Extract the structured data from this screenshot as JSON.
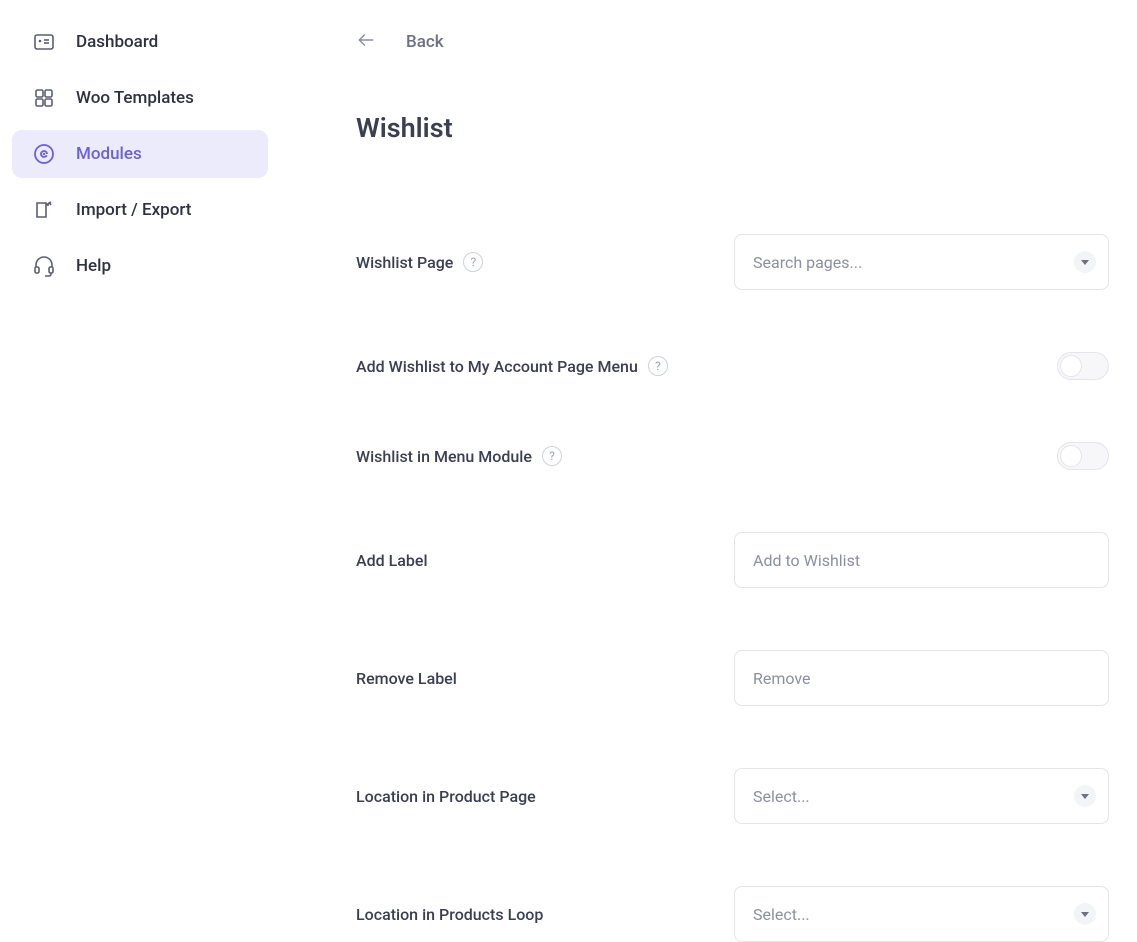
{
  "sidebar": {
    "items": [
      {
        "label": "Dashboard",
        "active": false
      },
      {
        "label": "Woo Templates",
        "active": false
      },
      {
        "label": "Modules",
        "active": true
      },
      {
        "label": "Import / Export",
        "active": false
      },
      {
        "label": "Help",
        "active": false
      }
    ]
  },
  "header": {
    "back_label": "Back",
    "title": "Wishlist"
  },
  "fields": {
    "wishlist_page": {
      "label": "Wishlist Page",
      "placeholder": "Search pages...",
      "has_help": true
    },
    "add_to_account_menu": {
      "label": "Add Wishlist to My Account Page Menu",
      "value": false,
      "has_help": true
    },
    "wishlist_in_menu_module": {
      "label": "Wishlist in Menu Module",
      "value": false,
      "has_help": true
    },
    "add_label": {
      "label": "Add Label",
      "placeholder": "Add to Wishlist",
      "value": ""
    },
    "remove_label": {
      "label": "Remove Label",
      "placeholder": "Remove",
      "value": ""
    },
    "location_product_page": {
      "label": "Location in Product Page",
      "placeholder": "Select..."
    },
    "location_products_loop": {
      "label": "Location in Products Loop",
      "placeholder": "Select..."
    }
  },
  "help_glyph": "?"
}
